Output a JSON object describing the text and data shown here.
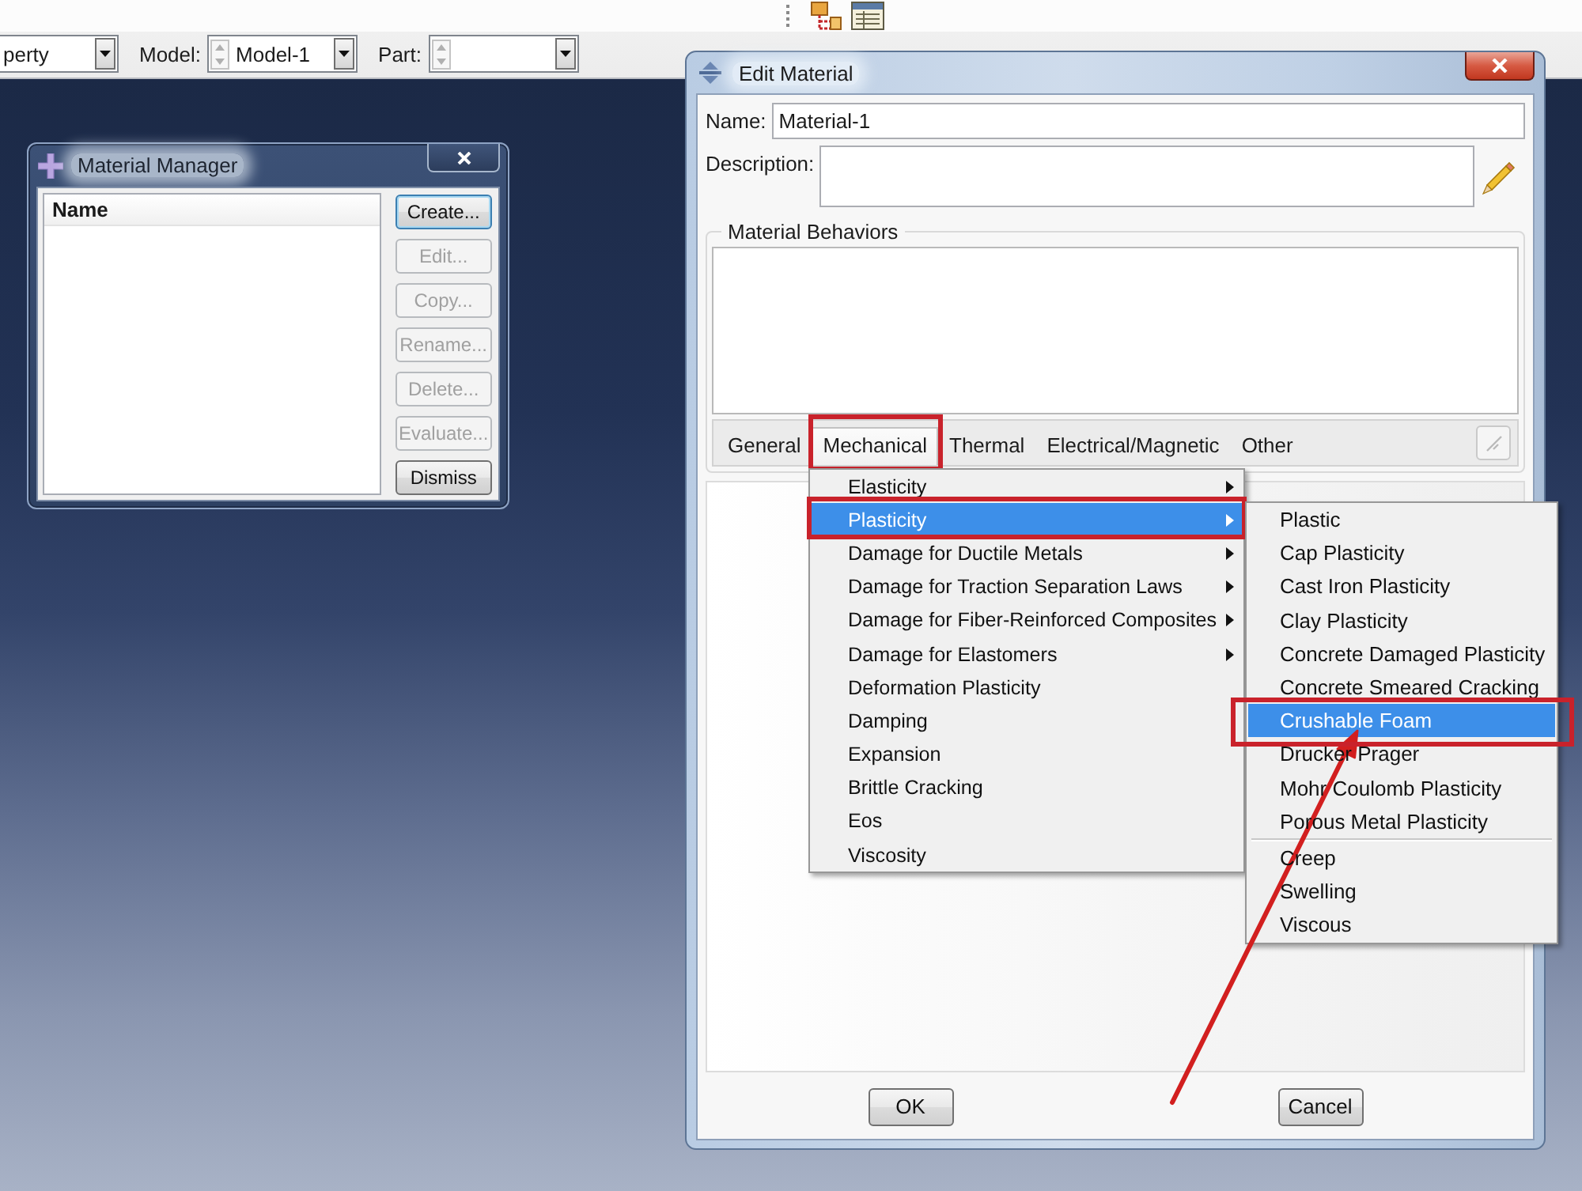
{
  "toolbar": {
    "fields": [
      {
        "kind": "combo",
        "value": "perty"
      },
      {
        "kind": "spin-combo",
        "label": "Model:",
        "value": "Model-1"
      },
      {
        "kind": "spin-combo",
        "label": "Part:"
      }
    ]
  },
  "material_manager": {
    "title": "Material Manager",
    "list": {
      "column": "Name"
    },
    "buttons": [
      {
        "label": "Create...",
        "disabled": false,
        "focused": true
      },
      {
        "label": "Edit...",
        "disabled": true,
        "focused": false
      },
      {
        "label": "Copy...",
        "disabled": true,
        "focused": false
      },
      {
        "label": "Rename...",
        "disabled": true,
        "focused": false
      },
      {
        "label": "Delete...",
        "disabled": true,
        "focused": false
      },
      {
        "label": "Evaluate...",
        "disabled": true,
        "focused": false
      },
      {
        "label": "Dismiss",
        "disabled": false,
        "focused": false
      }
    ]
  },
  "edit_material": {
    "title": "Edit Material",
    "name": {
      "label": "Name:",
      "value": "Material-1"
    },
    "description": {
      "label": "Description:"
    },
    "behaviors": {
      "title": "Material Behaviors"
    },
    "tabs": [
      {
        "label": "General",
        "selected": false,
        "outlined": false
      },
      {
        "label": "Mechanical",
        "selected": true,
        "outlined": true
      },
      {
        "label": "Thermal",
        "selected": false,
        "outlined": false
      },
      {
        "label": "Electrical/Magnetic",
        "selected": false,
        "outlined": false
      },
      {
        "label": "Other",
        "selected": false,
        "outlined": false
      }
    ],
    "tab_bar_button": {
      "disabled": true
    },
    "buttons": [
      {
        "label": "OK"
      },
      {
        "label": "Cancel"
      }
    ]
  },
  "menu": {
    "items": [
      {
        "label": "Elasticity",
        "submenu": true,
        "selected": false,
        "outlined": false
      },
      {
        "label": "Plasticity",
        "submenu": true,
        "selected": true,
        "outlined": true
      },
      {
        "label": "Damage for Ductile Metals",
        "submenu": true,
        "selected": false,
        "outlined": false
      },
      {
        "label": "Damage for Traction Separation Laws",
        "submenu": true,
        "selected": false,
        "outlined": false
      },
      {
        "label": "Damage for Fiber-Reinforced Composites",
        "submenu": true,
        "selected": false,
        "outlined": false
      },
      {
        "label": "Damage for Elastomers",
        "submenu": true,
        "selected": false,
        "outlined": false
      },
      {
        "label": "Deformation Plasticity",
        "submenu": false,
        "selected": false,
        "outlined": false
      },
      {
        "label": "Damping",
        "submenu": false,
        "selected": false,
        "outlined": false
      },
      {
        "label": "Expansion",
        "submenu": false,
        "selected": false,
        "outlined": false
      },
      {
        "label": "Brittle Cracking",
        "submenu": false,
        "selected": false,
        "outlined": false
      },
      {
        "label": "Eos",
        "submenu": false,
        "selected": false,
        "outlined": false
      },
      {
        "label": "Viscosity",
        "submenu": false,
        "selected": false,
        "outlined": false
      }
    ]
  },
  "submenu": {
    "sections": [
      {
        "items": [
          {
            "label": "Plastic",
            "selected": false,
            "outlined": false
          },
          {
            "label": "Cap Plasticity",
            "selected": false,
            "outlined": false
          },
          {
            "label": "Cast Iron Plasticity",
            "selected": false,
            "outlined": false
          },
          {
            "label": "Clay Plasticity",
            "selected": false,
            "outlined": false
          },
          {
            "label": "Concrete Damaged Plasticity",
            "selected": false,
            "outlined": false
          },
          {
            "label": "Concrete Smeared Cracking",
            "selected": false,
            "outlined": false
          },
          {
            "label": "Crushable Foam",
            "selected": true,
            "outlined": true
          },
          {
            "label": "Drucker Prager",
            "selected": false,
            "outlined": false
          },
          {
            "label": "Mohr Coulomb Plasticity",
            "selected": false,
            "outlined": false
          },
          {
            "label": "Porous Metal Plasticity",
            "selected": false,
            "outlined": false
          }
        ]
      },
      {
        "items": [
          {
            "label": "Creep",
            "selected": false,
            "outlined": false
          },
          {
            "label": "Swelling",
            "selected": false,
            "outlined": false
          },
          {
            "label": "Viscous",
            "selected": false,
            "outlined": false
          }
        ]
      }
    ]
  }
}
